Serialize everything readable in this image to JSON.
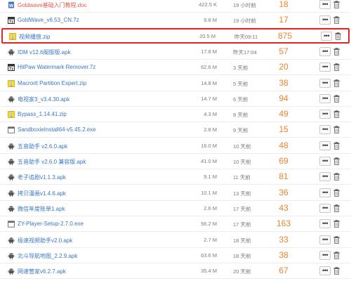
{
  "files": [
    {
      "name": "Goldwave基础入门教程.doc",
      "size": "422.5 K",
      "time": "19 小时前",
      "count": "18",
      "icon": "word-doc-icon",
      "name_red": true
    },
    {
      "name": "GoldWave_v6.53_CN.7z",
      "size": "9.8 M",
      "time": "19 小时前",
      "count": "17",
      "icon": "archive-7z-icon",
      "name_red": false
    },
    {
      "name": "视频播放.zip",
      "size": "20.5 M",
      "time": "昨天09:11",
      "count": "875",
      "icon": "zip-archive-icon",
      "name_red": false,
      "highlighted": true
    },
    {
      "name": "IDM v12.6阁版版.apk",
      "size": "17.8 M",
      "time": "昨天17:04",
      "count": "57",
      "icon": "android-icon",
      "name_red": false
    },
    {
      "name": "HitPaw Watermark Remover.7z",
      "size": "62.6 M",
      "time": "3 天前",
      "count": "20",
      "icon": "archive-7z-icon",
      "name_red": false
    },
    {
      "name": "Macrorit Partition Expert.zip",
      "size": "14.8 M",
      "time": "5 天前",
      "count": "38",
      "icon": "zip-archive-icon",
      "name_red": false
    },
    {
      "name": "电视家3_v3.4.30.apk",
      "size": "14.7 M",
      "time": "6 天前",
      "count": "94",
      "icon": "android-icon",
      "name_red": false
    },
    {
      "name": "Bypass_1.14.41.zip",
      "size": "4.3 M",
      "time": "8 天前",
      "count": "49",
      "icon": "zip-archive-icon",
      "name_red": false
    },
    {
      "name": "SandboxieInstall64-v5.45.2.exe",
      "size": "2.8 M",
      "time": "9 天前",
      "count": "15",
      "icon": "exe-window-icon",
      "name_red": false
    },
    {
      "name": "五音助手 v2.6.0.apk",
      "size": "16.0 M",
      "time": "10 天前",
      "count": "48",
      "icon": "android-icon",
      "name_red": false
    },
    {
      "name": "五音助手 v2.6.0 兼容版.apk",
      "size": "41.0 M",
      "time": "10 天前",
      "count": "69",
      "icon": "android-icon",
      "name_red": false
    },
    {
      "name": "老子追剧v1.1.3.apk",
      "size": "9.1 M",
      "time": "11 天前",
      "count": "81",
      "icon": "android-icon",
      "name_red": false
    },
    {
      "name": "拷贝漫画v1.4.6.apk",
      "size": "10.1 M",
      "time": "13 天前",
      "count": "36",
      "icon": "android-icon",
      "name_red": false
    },
    {
      "name": "微信年度账单1.apk",
      "size": "2.6 M",
      "time": "17 天前",
      "count": "43",
      "icon": "android-icon",
      "name_red": false
    },
    {
      "name": "ZY-Player-Setup-2.7.0.exe",
      "size": "56.2 M",
      "time": "17 天前",
      "count": "163",
      "icon": "exe-window-icon",
      "name_red": false
    },
    {
      "name": "极速视频助手v2.0.apk",
      "size": "2.7 M",
      "time": "18 天前",
      "count": "33",
      "icon": "android-icon",
      "name_red": false
    },
    {
      "name": "北斗导航地图_2.2.9.apk",
      "size": "63.6 M",
      "time": "18 天前",
      "count": "38",
      "icon": "android-icon",
      "name_red": false
    },
    {
      "name": "网速管家v6.2.7.apk",
      "size": "35.4 M",
      "time": "20 天前",
      "count": "67",
      "icon": "android-icon",
      "name_red": false
    }
  ],
  "actions": {
    "more_label": "•••",
    "trash_icon": "trash-icon"
  },
  "colors": {
    "name": "#3b76c4",
    "name_red": "#e05a4f",
    "count": "#f0812b",
    "highlight_border": "#e02525",
    "android": "#555555"
  }
}
